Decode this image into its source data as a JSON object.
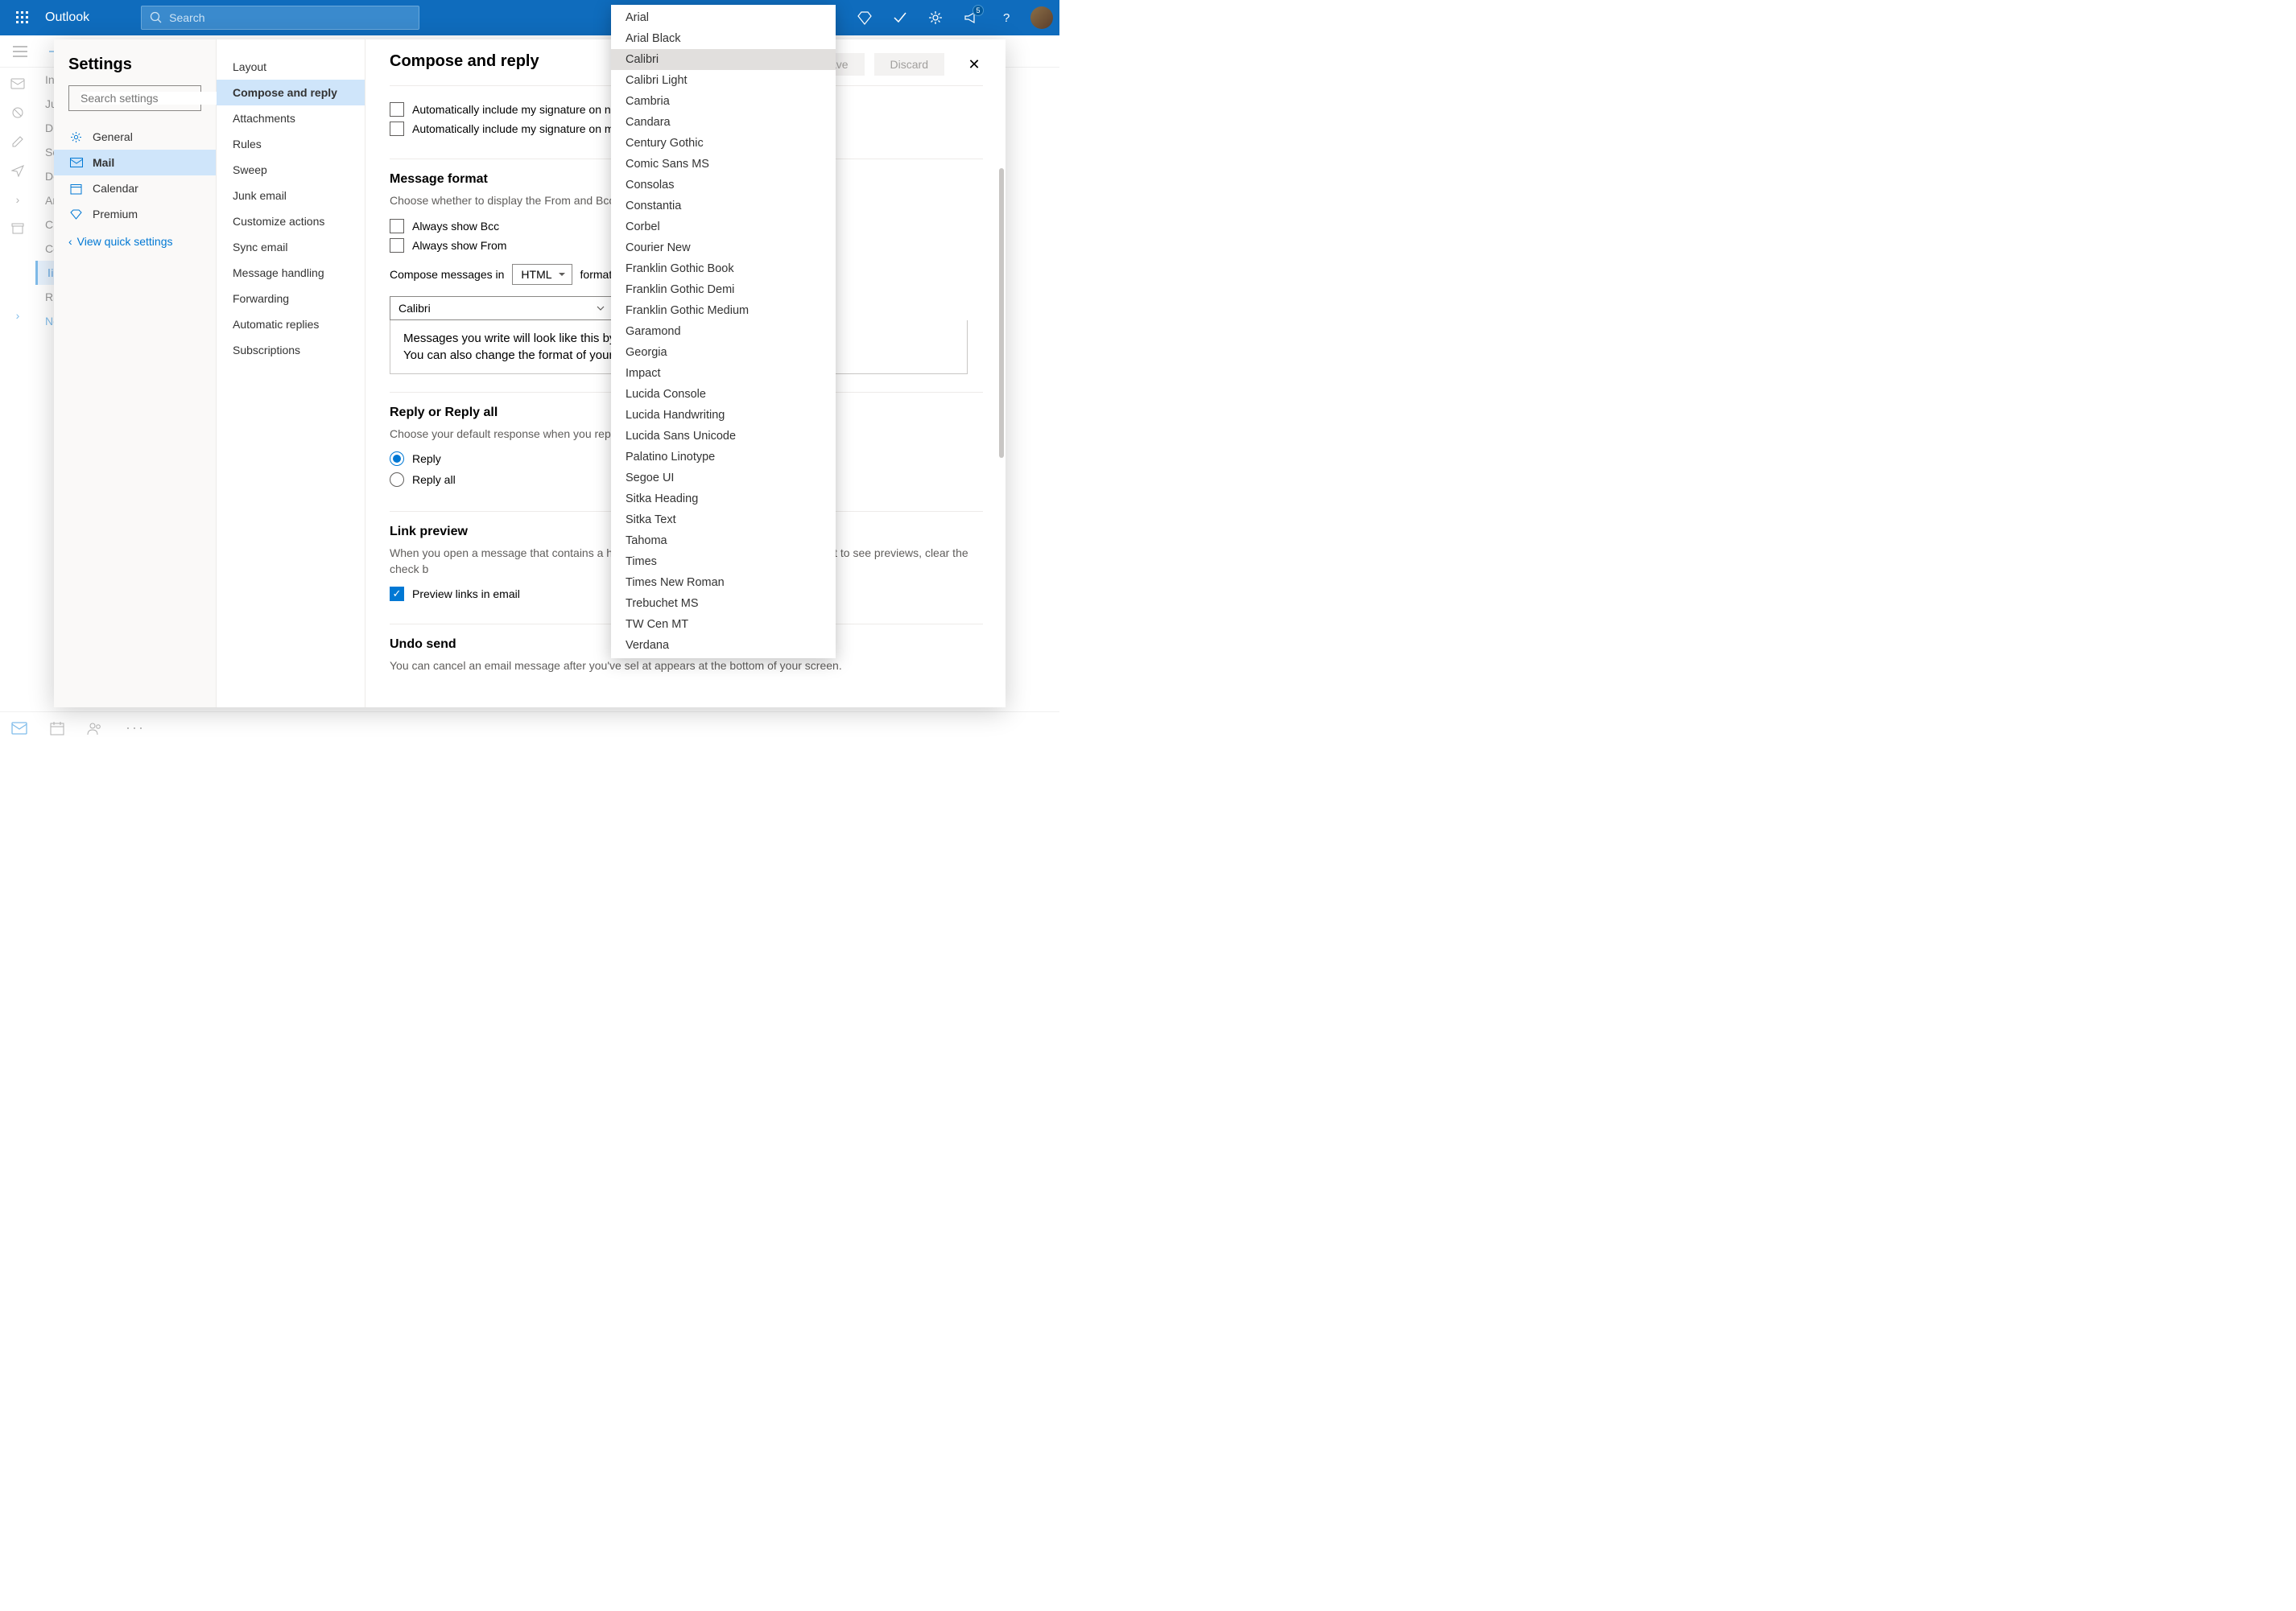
{
  "header": {
    "app_title": "Outlook",
    "search_placeholder": "Search",
    "notification_count": "5"
  },
  "folders": {
    "items": [
      "Inb",
      "Jur",
      "Dra",
      "Ser",
      "De",
      "Arc",
      "Clu",
      "Co"
    ],
    "active": "life",
    "below": [
      "RSS",
      "Ne"
    ]
  },
  "settings": {
    "title": "Settings",
    "search_placeholder": "Search settings",
    "nav1": {
      "general": "General",
      "mail": "Mail",
      "calendar": "Calendar",
      "premium": "Premium"
    },
    "quick": "View quick settings",
    "nav2": [
      "Layout",
      "Compose and reply",
      "Attachments",
      "Rules",
      "Sweep",
      "Junk email",
      "Customize actions",
      "Sync email",
      "Message handling",
      "Forwarding",
      "Automatic replies",
      "Subscriptions"
    ],
    "nav2_active_index": 1,
    "buttons": {
      "save": "Save",
      "discard": "Discard"
    }
  },
  "content": {
    "title": "Compose and reply",
    "sig": {
      "auto_new": "Automatically include my signature on new",
      "auto_reply": "Automatically include my signature on mess"
    },
    "msgfmt": {
      "heading": "Message format",
      "desc": "Choose whether to display the From and Bcc line",
      "show_bcc": "Always show Bcc",
      "show_from": "Always show From",
      "compose_in": "Compose messages in",
      "html": "HTML",
      "format_suffix": "format",
      "font_selected": "Calibri",
      "preview1": "Messages you write will look like this by",
      "preview2": "You can also change the format of your"
    },
    "reply": {
      "heading": "Reply or Reply all",
      "desc": "Choose your default response when you reply fro",
      "reply": "Reply",
      "reply_all": "Reply all"
    },
    "link": {
      "heading": "Link preview",
      "desc": "When you open a message that contains a hyper                                                                          preview of the website. If you don't want to see previews, clear the check b",
      "check": "Preview links in email"
    },
    "undo": {
      "heading": "Undo send",
      "desc": "You can cancel an email message after you've sel                                                                       at appears at the bottom of your screen."
    }
  },
  "font_list": [
    "Arial",
    "Arial Black",
    "Calibri",
    "Calibri Light",
    "Cambria",
    "Candara",
    "Century Gothic",
    "Comic Sans MS",
    "Consolas",
    "Constantia",
    "Corbel",
    "Courier New",
    "Franklin Gothic Book",
    "Franklin Gothic Demi",
    "Franklin Gothic Medium",
    "Garamond",
    "Georgia",
    "Impact",
    "Lucida Console",
    "Lucida Handwriting",
    "Lucida Sans Unicode",
    "Palatino Linotype",
    "Segoe UI",
    "Sitka Heading",
    "Sitka Text",
    "Tahoma",
    "Times",
    "Times New Roman",
    "Trebuchet MS",
    "TW Cen MT",
    "Verdana"
  ],
  "font_selected_index": 2
}
